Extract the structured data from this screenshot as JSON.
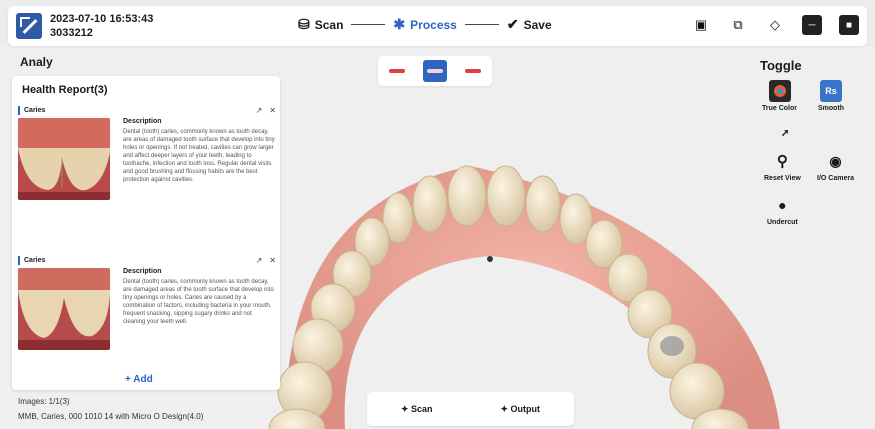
{
  "topbar": {
    "datetime": "2023-07-10 16:53:43",
    "patient_id": "3033212",
    "steps": [
      {
        "label": "Scan",
        "icon": "scan-icon"
      },
      {
        "label": "Process",
        "icon": "process-icon"
      },
      {
        "label": "Save",
        "icon": "save-icon"
      }
    ],
    "active_step": "Process",
    "tools": [
      "screenshot-icon",
      "export-icon",
      "settings-icon",
      "minimize-icon",
      "close-icon"
    ]
  },
  "analysis": {
    "title": "Analy",
    "views": [
      "upper-jaw-view-icon",
      "both-jaws-view-icon",
      "lower-jaw-view-icon"
    ],
    "active_view": 1
  },
  "report": {
    "title": "Health Report(3)",
    "items": [
      {
        "label": "Caries",
        "desc_label": "Description",
        "desc": "Dental (tooth) caries, commonly known as tooth decay, are areas of damaged tooth surface that develop into tiny holes or openings. If not treated, cavities can grow larger and affect deeper layers of your teeth, leading to toothache, infection and tooth loss. Regular dental visits and good brushing and flossing habits are the best protection against cavities."
      },
      {
        "label": "Caries",
        "desc_label": "Description",
        "desc": "Dental (tooth) caries, commonly known as tooth decay, are damaged areas of the tooth surface that develop into tiny openings or holes. Caries are caused by a combination of factors, including bacteria in your mouth, frequent snacking, sipping sugary drinks and not cleaning your teeth well."
      }
    ],
    "add_label": "Add",
    "images_line": "Images: 1/1(3)",
    "device_line": "MMB, Caries, 000 1010 14 with Micro O Design(4.0)"
  },
  "bottom": {
    "scan_label": "Scan",
    "output_label": "Output"
  },
  "toggle": {
    "title": "Toggle",
    "items": [
      {
        "label": "True Color",
        "icon": "true-color-icon"
      },
      {
        "label": "Smooth",
        "icon": "smooth-icon"
      },
      {
        "label": "Reset View",
        "icon": "reset-view-icon"
      },
      {
        "label": "I/O Camera",
        "icon": "io-camera-icon"
      },
      {
        "label": "Undercut",
        "icon": "undercut-icon"
      }
    ]
  },
  "colors": {
    "accent": "#2f64c2",
    "gum": "#e9a69b",
    "tooth": "#efe2c6"
  }
}
